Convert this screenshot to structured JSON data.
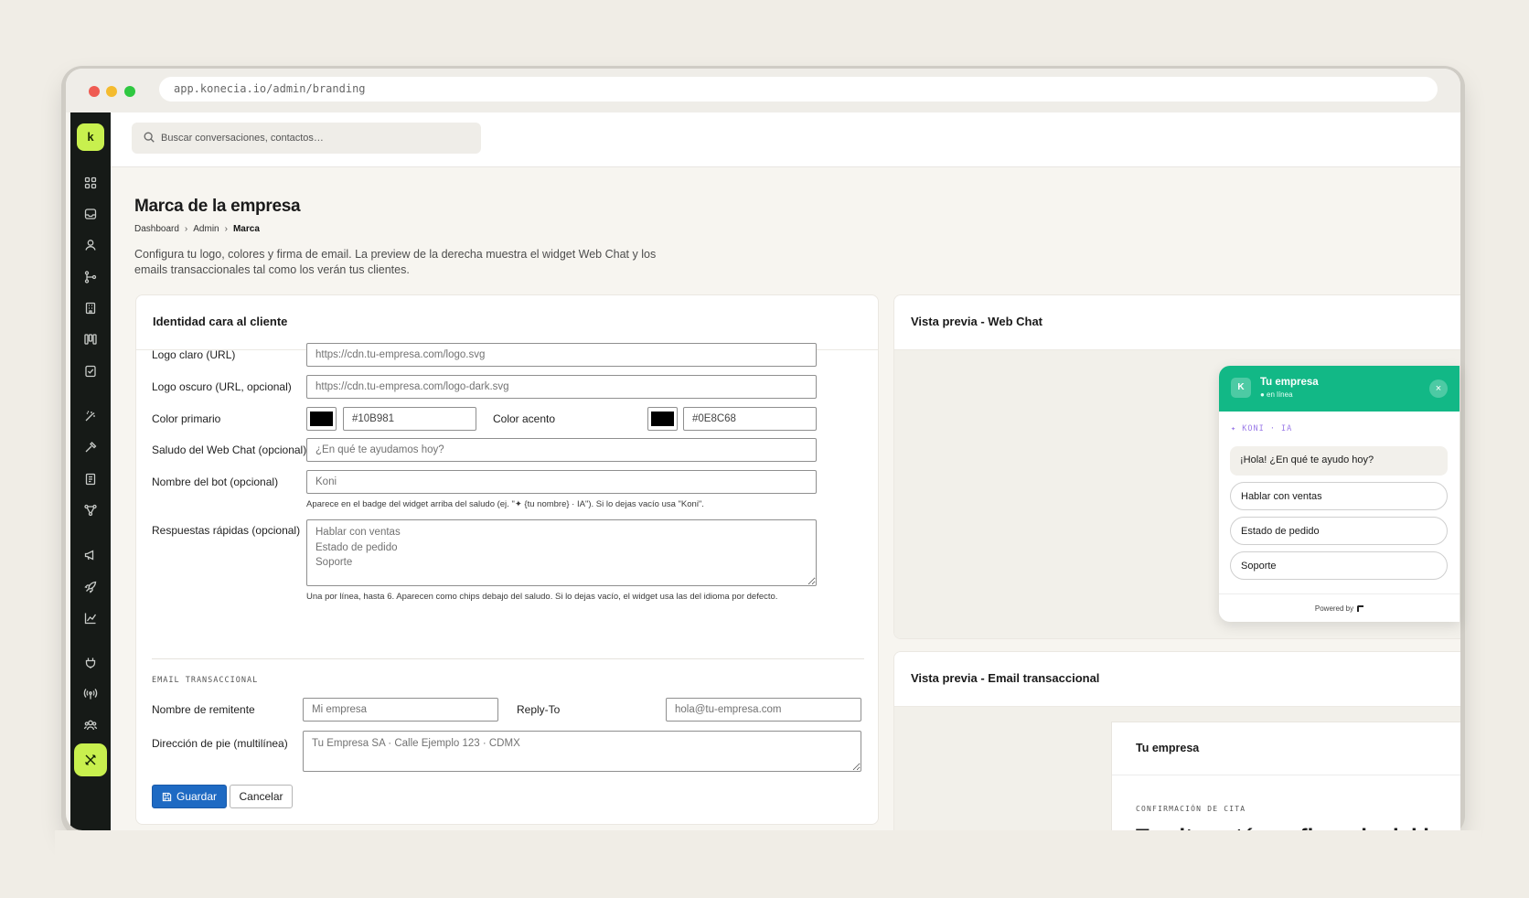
{
  "browser": {
    "url": "app.konecia.io/admin/branding"
  },
  "sidebar": {
    "logo_letter": "k",
    "items": [
      {
        "icon": "grid-icon"
      },
      {
        "icon": "inbox-icon"
      },
      {
        "icon": "user-icon"
      },
      {
        "icon": "branch-icon"
      },
      {
        "icon": "building-icon"
      },
      {
        "icon": "kanban-icon"
      },
      {
        "icon": "checklist-icon"
      },
      {
        "icon": "magic-wand-icon"
      },
      {
        "icon": "hammer-icon"
      },
      {
        "icon": "book-icon"
      },
      {
        "icon": "flow-icon"
      },
      {
        "icon": "megaphone-icon"
      },
      {
        "icon": "rocket-icon"
      },
      {
        "icon": "chart-icon"
      },
      {
        "icon": "plug-icon"
      },
      {
        "icon": "broadcast-icon"
      },
      {
        "icon": "team-icon"
      },
      {
        "icon": "tools-icon",
        "active": true
      }
    ],
    "accent_color": "#c8f04e",
    "background_color": "#161a17"
  },
  "topbar": {
    "search_placeholder": "Buscar conversaciones, contactos…"
  },
  "page": {
    "title": "Marca de la empresa",
    "breadcrumb": [
      "Dashboard",
      "Admin",
      "Marca"
    ],
    "intro": "Configura tu logo, colores y firma de email. La preview de la derecha muestra el widget Web Chat y los emails transaccionales tal como los verán tus clientes."
  },
  "form": {
    "card_title": "Identidad cara al cliente",
    "logo_light_label": "Logo claro (URL)",
    "logo_light_placeholder": "https://cdn.tu-empresa.com/logo.svg",
    "logo_dark_label": "Logo oscuro (URL, opcional)",
    "logo_dark_placeholder": "https://cdn.tu-empresa.com/logo-dark.svg",
    "primary_color_label": "Color primario",
    "primary_color_value": "#10B981",
    "accent_color_label": "Color acento",
    "accent_color_value": "#0E8C68",
    "greeting_label": "Saludo del Web Chat (opcional)",
    "greeting_placeholder": "¿En qué te ayudamos hoy?",
    "bot_name_label": "Nombre del bot (opcional)",
    "bot_name_placeholder": "Koni",
    "bot_name_hint": "Aparece en el badge del widget arriba del saludo (ej. \"✦ {tu nombre} · IA\"). Si lo dejas vacío usa \"Koni\".",
    "quick_replies_label": "Respuestas rápidas (opcional)",
    "quick_replies_placeholder": "Hablar con ventas\nEstado de pedido\nSoporte",
    "quick_replies_hint": "Una por línea, hasta 6. Aparecen como chips debajo del saludo. Si lo dejas vacío, el widget usa las del idioma por defecto.",
    "email_section_label": "EMAIL TRANSACCIONAL",
    "sender_name_label": "Nombre de remitente",
    "sender_name_placeholder": "Mi empresa",
    "reply_to_label": "Reply-To",
    "reply_to_placeholder": "hola@tu-empresa.com",
    "footer_address_label": "Dirección de pie (multilínea)",
    "footer_address_placeholder": "Tu Empresa SA · Calle Ejemplo 123 · CDMX",
    "save_label": "Guardar",
    "cancel_label": "Cancelar",
    "save_color": "#1e6ac3"
  },
  "webchat_preview": {
    "card_title": "Vista previa - Web Chat",
    "header_color": "#12b886",
    "avatar_letter": "K",
    "company_name": "Tu empresa",
    "status": "● en línea",
    "close_glyph": "×",
    "badge": "✦ KONI · IA",
    "greeting": "¡Hola! ¿En qué te ayudo hoy?",
    "chips": [
      "Hablar con ventas",
      "Estado de pedido",
      "Soporte"
    ],
    "footer": "Powered by"
  },
  "email_preview": {
    "card_title": "Vista previa - Email transaccional",
    "brand": "Tu empresa",
    "kicker": "CONFIRMACIÓN DE CITA",
    "headline": "Tu cita está confirmada del lunes"
  }
}
